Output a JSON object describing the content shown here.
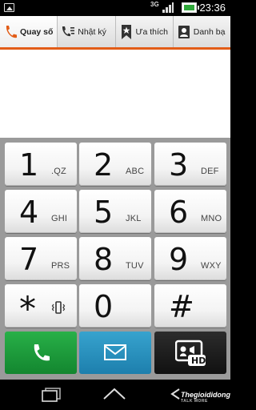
{
  "status_bar": {
    "network": "3G",
    "time": "23:36"
  },
  "tabs": [
    {
      "label": "Quay số",
      "icon": "phone-handset-icon",
      "active": true
    },
    {
      "label": "Nhật ký",
      "icon": "call-log-icon",
      "active": false
    },
    {
      "label": "Ưa thích",
      "icon": "favorites-star-icon",
      "active": false
    },
    {
      "label": "Danh bạ",
      "icon": "contacts-icon",
      "active": false
    }
  ],
  "keypad": {
    "keys": [
      {
        "digit": "1",
        "letters": ".QZ"
      },
      {
        "digit": "2",
        "letters": "ABC"
      },
      {
        "digit": "3",
        "letters": "DEF"
      },
      {
        "digit": "4",
        "letters": "GHI"
      },
      {
        "digit": "5",
        "letters": "JKL"
      },
      {
        "digit": "6",
        "letters": "MNO"
      },
      {
        "digit": "7",
        "letters": "PRS"
      },
      {
        "digit": "8",
        "letters": "TUV"
      },
      {
        "digit": "9",
        "letters": "WXY"
      },
      {
        "digit": "*",
        "letters": ""
      },
      {
        "digit": "0",
        "letters": ""
      },
      {
        "digit": "#",
        "letters": ""
      }
    ],
    "star_key_icon": "vibrate-icon"
  },
  "actions": {
    "call_icon": "phone-handset-icon",
    "message_icon": "envelope-icon",
    "video_call_icon": "hd-video-call-icon",
    "video_badge": "HD"
  },
  "nav": {
    "back_icon": "back-icon",
    "home_icon": "home-icon",
    "recent_icon": "recent-apps-icon"
  },
  "watermark": {
    "brand": "Thegioididong",
    "tagline": "TALK MORE"
  },
  "colors": {
    "accent": "#e25c17",
    "call": "#1a9a3a",
    "message": "#2a90bd",
    "video": "#1a1a1a"
  }
}
